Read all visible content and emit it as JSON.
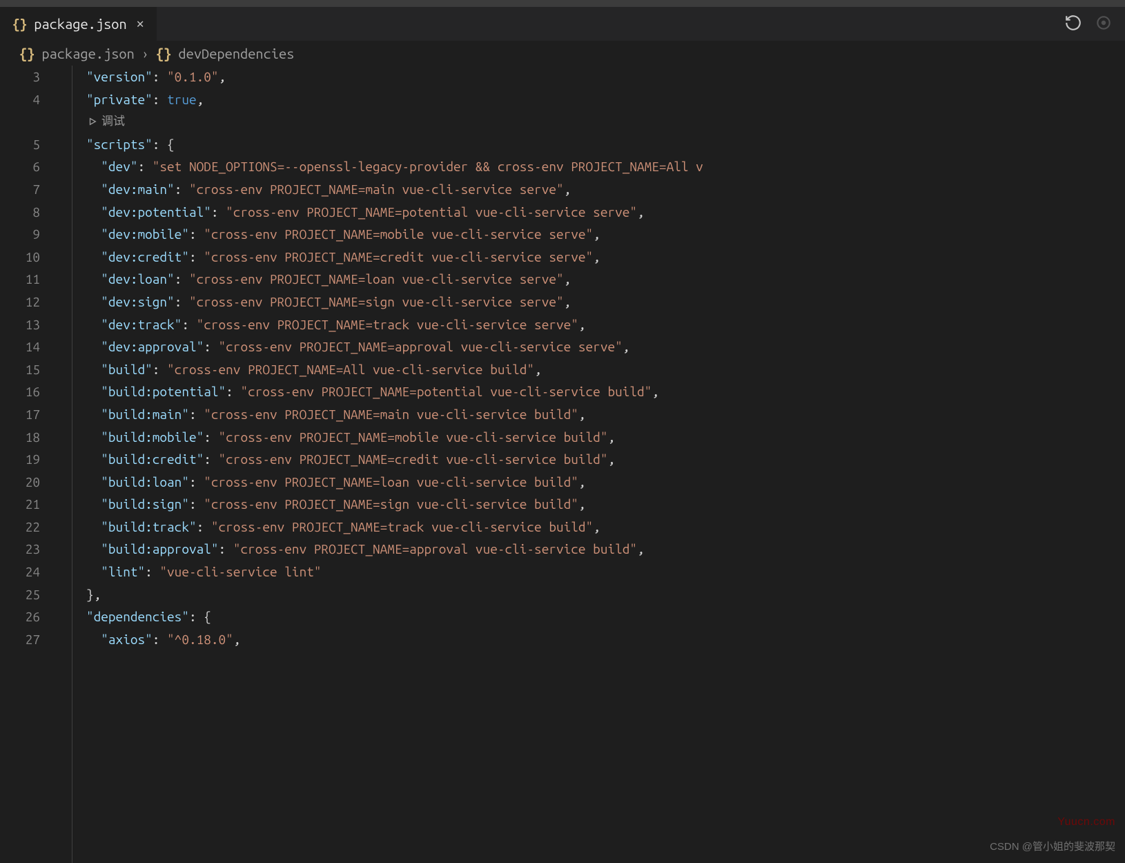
{
  "tab": {
    "icon": "{}",
    "label": "package.json"
  },
  "breadcrumb": {
    "icon1": "{}",
    "file": "package.json",
    "icon2": "{}",
    "section": "devDependencies"
  },
  "codelens": {
    "label": "调试"
  },
  "lines": [
    {
      "n": "3",
      "indent": 1,
      "key": "version",
      "sep": ": ",
      "val": "\"0.1.0\"",
      "valcls": "str",
      "trail": ","
    },
    {
      "n": "4",
      "indent": 1,
      "key": "private",
      "sep": ": ",
      "val": "true",
      "valcls": "bool",
      "trail": ","
    },
    {
      "n": "",
      "indent": 1,
      "codelens": true
    },
    {
      "n": "5",
      "indent": 1,
      "key": "scripts",
      "sep": ": ",
      "val": "{",
      "valcls": "punct",
      "trail": ""
    },
    {
      "n": "6",
      "indent": 2,
      "key": "dev",
      "sep": ": ",
      "val": "\"set NODE_OPTIONS=--openssl-legacy-provider && cross-env PROJECT_NAME=All v",
      "valcls": "str",
      "trail": ""
    },
    {
      "n": "7",
      "indent": 2,
      "key": "dev:main",
      "sep": ": ",
      "val": "\"cross-env PROJECT_NAME=main vue-cli-service serve\"",
      "valcls": "str",
      "trail": ","
    },
    {
      "n": "8",
      "indent": 2,
      "key": "dev:potential",
      "sep": ": ",
      "val": "\"cross-env PROJECT_NAME=potential vue-cli-service serve\"",
      "valcls": "str",
      "trail": ","
    },
    {
      "n": "9",
      "indent": 2,
      "key": "dev:mobile",
      "sep": ": ",
      "val": "\"cross-env PROJECT_NAME=mobile vue-cli-service serve\"",
      "valcls": "str",
      "trail": ","
    },
    {
      "n": "10",
      "indent": 2,
      "key": "dev:credit",
      "sep": ": ",
      "val": "\"cross-env PROJECT_NAME=credit vue-cli-service serve\"",
      "valcls": "str",
      "trail": ","
    },
    {
      "n": "11",
      "indent": 2,
      "key": "dev:loan",
      "sep": ": ",
      "val": "\"cross-env PROJECT_NAME=loan vue-cli-service serve\"",
      "valcls": "str",
      "trail": ","
    },
    {
      "n": "12",
      "indent": 2,
      "key": "dev:sign",
      "sep": ": ",
      "val": "\"cross-env PROJECT_NAME=sign vue-cli-service serve\"",
      "valcls": "str",
      "trail": ","
    },
    {
      "n": "13",
      "indent": 2,
      "key": "dev:track",
      "sep": ": ",
      "val": "\"cross-env PROJECT_NAME=track vue-cli-service serve\"",
      "valcls": "str",
      "trail": ","
    },
    {
      "n": "14",
      "indent": 2,
      "key": "dev:approval",
      "sep": ": ",
      "val": "\"cross-env PROJECT_NAME=approval vue-cli-service serve\"",
      "valcls": "str",
      "trail": ","
    },
    {
      "n": "15",
      "indent": 2,
      "key": "build",
      "sep": ": ",
      "val": "\"cross-env PROJECT_NAME=All vue-cli-service build\"",
      "valcls": "str",
      "trail": ","
    },
    {
      "n": "16",
      "indent": 2,
      "key": "build:potential",
      "sep": ": ",
      "val": "\"cross-env PROJECT_NAME=potential vue-cli-service build\"",
      "valcls": "str",
      "trail": ","
    },
    {
      "n": "17",
      "indent": 2,
      "key": "build:main",
      "sep": ": ",
      "val": "\"cross-env PROJECT_NAME=main vue-cli-service build\"",
      "valcls": "str",
      "trail": ","
    },
    {
      "n": "18",
      "indent": 2,
      "key": "build:mobile",
      "sep": ": ",
      "val": "\"cross-env PROJECT_NAME=mobile vue-cli-service build\"",
      "valcls": "str",
      "trail": ","
    },
    {
      "n": "19",
      "indent": 2,
      "key": "build:credit",
      "sep": ": ",
      "val": "\"cross-env PROJECT_NAME=credit vue-cli-service build\"",
      "valcls": "str",
      "trail": ","
    },
    {
      "n": "20",
      "indent": 2,
      "key": "build:loan",
      "sep": ": ",
      "val": "\"cross-env PROJECT_NAME=loan vue-cli-service build\"",
      "valcls": "str",
      "trail": ","
    },
    {
      "n": "21",
      "indent": 2,
      "key": "build:sign",
      "sep": ": ",
      "val": "\"cross-env PROJECT_NAME=sign vue-cli-service build\"",
      "valcls": "str",
      "trail": ","
    },
    {
      "n": "22",
      "indent": 2,
      "key": "build:track",
      "sep": ": ",
      "val": "\"cross-env PROJECT_NAME=track vue-cli-service build\"",
      "valcls": "str",
      "trail": ","
    },
    {
      "n": "23",
      "indent": 2,
      "key": "build:approval",
      "sep": ": ",
      "val": "\"cross-env PROJECT_NAME=approval vue-cli-service build\"",
      "valcls": "str",
      "trail": ","
    },
    {
      "n": "24",
      "indent": 2,
      "key": "lint",
      "sep": ": ",
      "val": "\"vue-cli-service lint\"",
      "valcls": "str",
      "trail": ""
    },
    {
      "n": "25",
      "indent": 1,
      "raw": "},",
      "rawcls": "punct"
    },
    {
      "n": "26",
      "indent": 1,
      "key": "dependencies",
      "sep": ": ",
      "val": "{",
      "valcls": "punct",
      "trail": ""
    },
    {
      "n": "27",
      "indent": 2,
      "key": "axios",
      "sep": ": ",
      "val": "\"^0.18.0\"",
      "valcls": "str",
      "trail": ","
    }
  ],
  "watermarks": {
    "w1": "Yuucn.com",
    "w2": "CSDN @管小姐的斐波那契"
  }
}
